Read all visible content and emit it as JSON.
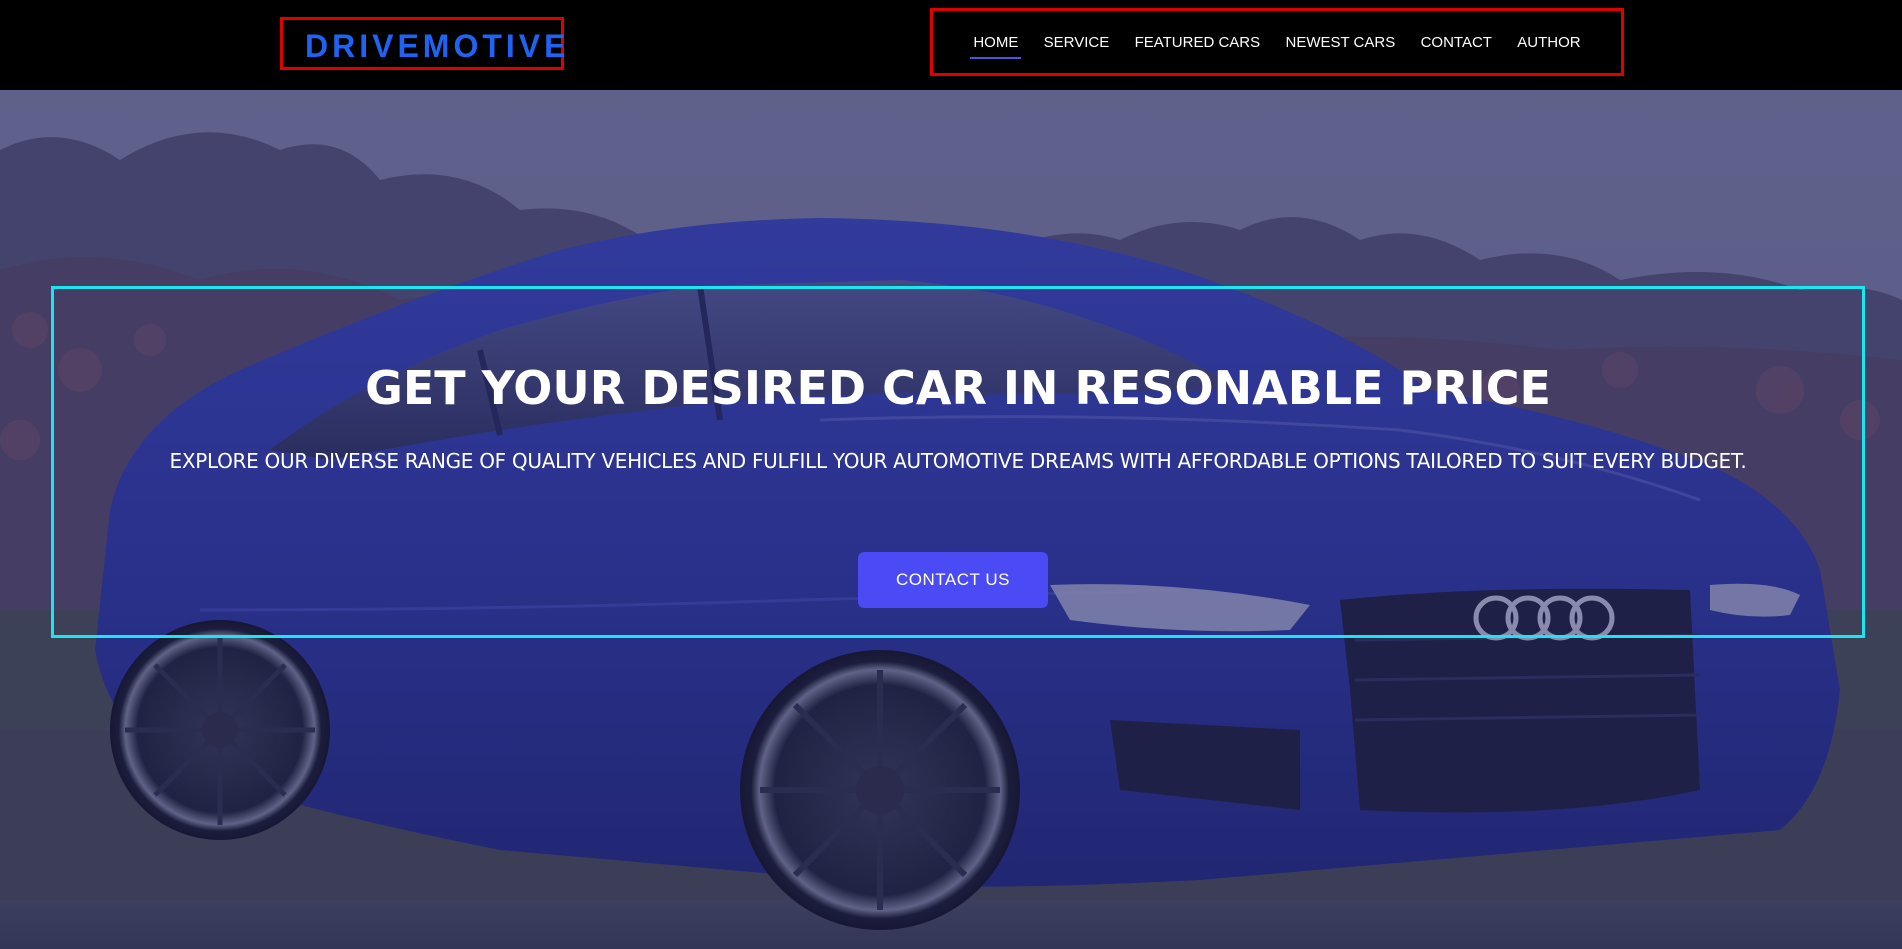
{
  "brand": {
    "name": "DRIVEMOTIVE",
    "color": "#1f63f2"
  },
  "nav": {
    "items": [
      {
        "label": "HOME",
        "active": true
      },
      {
        "label": "SERVICE"
      },
      {
        "label": "FEATURED CARS"
      },
      {
        "label": "NEWEST CARS"
      },
      {
        "label": "CONTACT"
      },
      {
        "label": "AUTHOR"
      }
    ],
    "active_indicator_color": "#3f5bd8"
  },
  "hero": {
    "title": "GET YOUR DESIRED CAR IN RESONABLE PRICE",
    "subtitle": "EXPLORE OUR DIVERSE RANGE OF QUALITY VEHICLES AND FULFILL YOUR AUTOMOTIVE DREAMS WITH AFFORDABLE OPTIONS TAILORED TO SUIT EVERY BUDGET.",
    "cta_label": "CONTACT US",
    "cta_color": "#4b4bf5",
    "background_image": "blue-audi-sedan-photo"
  },
  "colors": {
    "header_bg": "#000000",
    "highlight_red": "#e00000",
    "highlight_cyan": "#19e6ef",
    "overlay": "#2a2c6a"
  }
}
